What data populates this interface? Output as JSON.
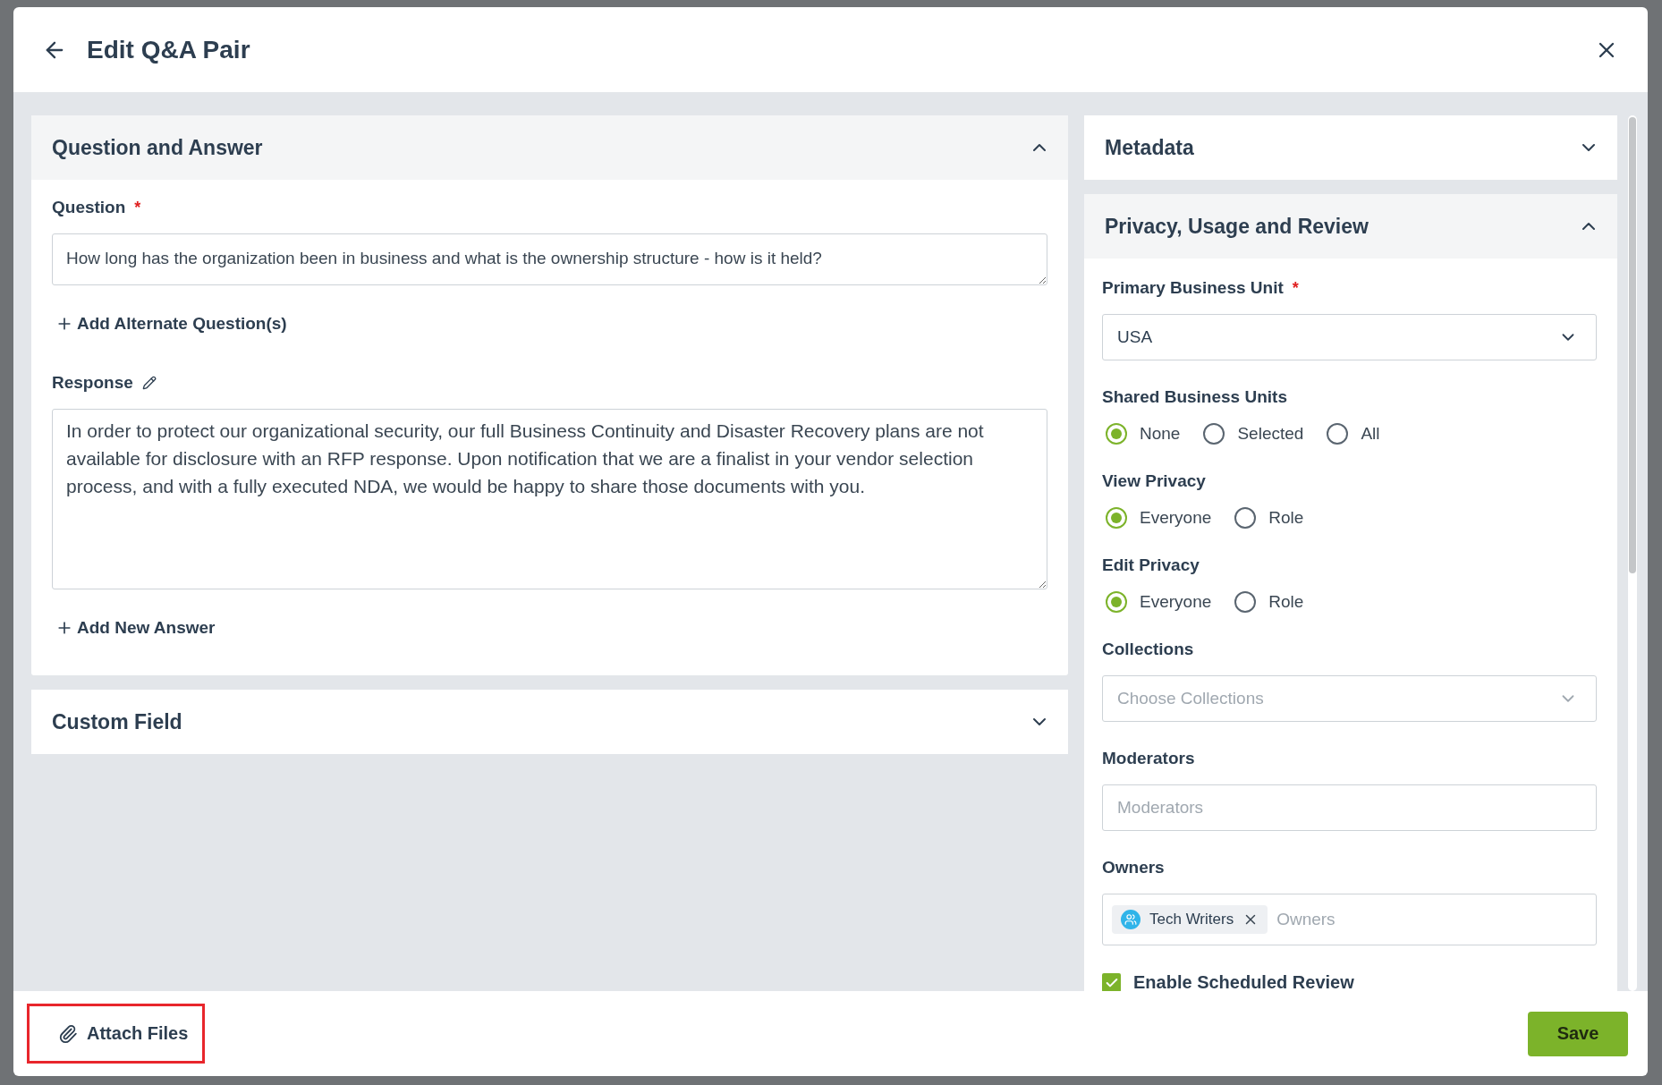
{
  "dialog": {
    "title": "Edit Q&A Pair"
  },
  "left_sections": [
    {
      "kind": "qa",
      "title": "Question and Answer",
      "expanded": true,
      "question_label": "Question",
      "question_required_mark": "*",
      "question_value": "How long has the organization been in business and what is the ownership structure - how is it held?",
      "add_alternate": "Add Alternate Question(s)",
      "response_label": "Response",
      "response_value": "In order to protect our organizational security, our full Business Continuity and Disaster Recovery plans are not available for disclosure with an RFP response. Upon notification that we are a finalist in your vendor selection process, and with a fully executed NDA, we would be happy to share those documents with you.",
      "add_answer": "Add New Answer"
    },
    {
      "kind": "collapsed",
      "title": "Custom Field",
      "expanded": false
    }
  ],
  "metadata": {
    "title": "Metadata",
    "expanded": false
  },
  "privacy": {
    "title": "Privacy, Usage and Review",
    "expanded": true,
    "fields": [
      {
        "kind": "select",
        "label": "Primary Business Unit",
        "required_mark": "*",
        "value": "USA"
      },
      {
        "kind": "radio",
        "label": "Shared Business Units",
        "options": [
          {
            "label": "None",
            "selected": true
          },
          {
            "label": "Selected",
            "selected": false
          },
          {
            "label": "All",
            "selected": false
          }
        ]
      },
      {
        "kind": "radio",
        "label": "View Privacy",
        "options": [
          {
            "label": "Everyone",
            "selected": true
          },
          {
            "label": "Role",
            "selected": false
          }
        ]
      },
      {
        "kind": "radio",
        "label": "Edit Privacy",
        "options": [
          {
            "label": "Everyone",
            "selected": true
          },
          {
            "label": "Role",
            "selected": false
          }
        ]
      },
      {
        "kind": "select",
        "label": "Collections",
        "placeholder": "Choose Collections"
      },
      {
        "kind": "input",
        "label": "Moderators",
        "placeholder": "Moderators"
      },
      {
        "kind": "tags",
        "label": "Owners",
        "tags": [
          "Tech Writers"
        ],
        "placeholder": "Owners"
      },
      {
        "kind": "checkbox",
        "label": "Enable Scheduled Review",
        "checked": true
      }
    ]
  },
  "footer": {
    "attach": "Attach Files",
    "attach_highlighted": true,
    "save": "Save"
  }
}
